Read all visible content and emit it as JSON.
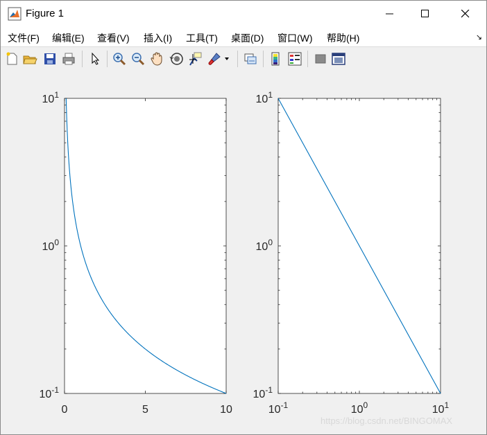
{
  "window": {
    "title": "Figure 1",
    "controls": {
      "minimize": "minimize",
      "maximize": "maximize",
      "close": "close"
    }
  },
  "menubar": {
    "items": [
      {
        "label": "文件(F)"
      },
      {
        "label": "编辑(E)"
      },
      {
        "label": "查看(V)"
      },
      {
        "label": "插入(I)"
      },
      {
        "label": "工具(T)"
      },
      {
        "label": "桌面(D)"
      },
      {
        "label": "窗口(W)"
      },
      {
        "label": "帮助(H)"
      }
    ],
    "overflow_icon": "menu-overflow-arrow"
  },
  "toolbar": {
    "icons": [
      "new-figure-icon",
      "open-icon",
      "save-icon",
      "print-icon",
      "edit-pointer-icon",
      "zoom-in-icon",
      "zoom-out-icon",
      "pan-icon",
      "rotate-3d-icon",
      "data-cursor-icon",
      "brush-icon",
      "link-plot-icon",
      "colorbar-icon",
      "legend-icon",
      "hide-plot-tools-icon",
      "show-plot-tools-icon"
    ]
  },
  "chart_data": [
    {
      "type": "line",
      "function": "y = 1/x",
      "x": [
        0.1,
        0.2,
        0.5,
        1,
        2,
        3,
        4,
        5,
        6,
        7,
        8,
        9,
        10
      ],
      "y": [
        10,
        5,
        2,
        1,
        0.5,
        0.3333,
        0.25,
        0.2,
        0.1667,
        0.1429,
        0.125,
        0.1111,
        0.1
      ],
      "xscale": "linear",
      "yscale": "log",
      "xlim": [
        0,
        10
      ],
      "ylim": [
        0.1,
        10
      ],
      "xticks": [
        "0",
        "5",
        "10"
      ],
      "yticks": [
        {
          "base": "10",
          "exp": "1"
        },
        {
          "base": "10",
          "exp": "0"
        },
        {
          "base": "10",
          "exp": "-1"
        }
      ],
      "color": "#0072bd"
    },
    {
      "type": "line",
      "function": "y = 1/x",
      "x": [
        0.1,
        1,
        10
      ],
      "y": [
        10,
        1,
        0.1
      ],
      "xscale": "log",
      "yscale": "log",
      "xlim": [
        0.1,
        10
      ],
      "ylim": [
        0.1,
        10
      ],
      "xticks": [
        {
          "base": "10",
          "exp": "-1"
        },
        {
          "base": "10",
          "exp": "0"
        },
        {
          "base": "10",
          "exp": "1"
        }
      ],
      "yticks": [
        {
          "base": "10",
          "exp": "1"
        },
        {
          "base": "10",
          "exp": "0"
        },
        {
          "base": "10",
          "exp": "-1"
        }
      ],
      "color": "#0072bd"
    }
  ],
  "watermark": "https://blog.csdn.net/BINGOMAX"
}
